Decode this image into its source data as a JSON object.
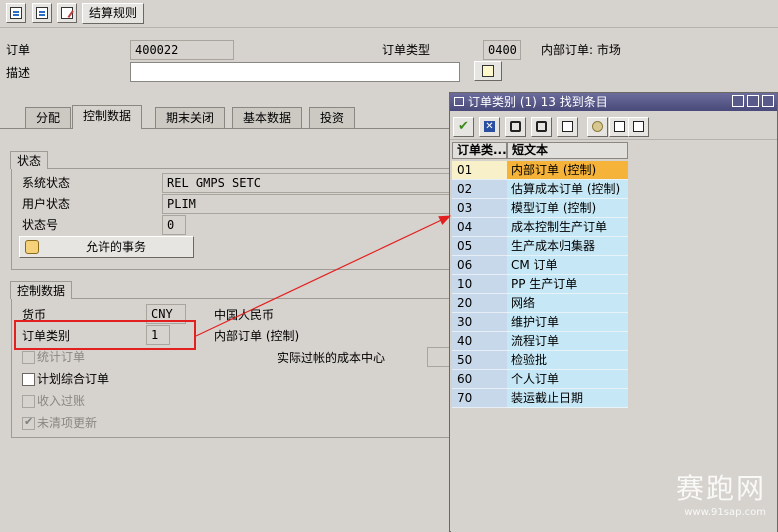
{
  "toolbar": {
    "settlement_rule_label": "结算规则"
  },
  "header": {
    "order_label": "订单",
    "order_value": "400022",
    "order_type_label": "订单类型",
    "order_type_value": "0400",
    "order_type_text": "内部订单: 市场",
    "description_label": "描述",
    "description_value": ""
  },
  "tabs": [
    {
      "label": "分配"
    },
    {
      "label": "控制数据"
    },
    {
      "label": "期末关闭"
    },
    {
      "label": "基本数据"
    },
    {
      "label": "投资"
    }
  ],
  "status_group": {
    "title": "状态",
    "system_status_label": "系统状态",
    "system_status_value": "REL  GMPS SETC",
    "user_status_label": "用户状态",
    "user_status_value": "PLIM",
    "status_number_label": "状态号",
    "status_number_value": "0",
    "allowed_transactions_label": "允许的事务"
  },
  "control_group": {
    "title": "控制数据",
    "currency_label": "货币",
    "currency_value": "CNY",
    "currency_text": "中国人民币",
    "order_category_label": "订单类别",
    "order_category_value": "1",
    "order_category_text": "内部订单 (控制)",
    "statistical_order_label": "统计订单",
    "actual_cost_center_label": "实际过帐的成本中心",
    "plan_integrated_label": "计划综合订单",
    "revenue_posting_label": "收入过账",
    "commitment_update_label": "未清项更新"
  },
  "popup": {
    "title": "订单类别 (1)  13 找到条目",
    "col_code": "订单类...",
    "col_text": "短文本",
    "rows": [
      {
        "code": "01",
        "text": "内部订单 (控制)"
      },
      {
        "code": "02",
        "text": "估算成本订单 (控制)"
      },
      {
        "code": "03",
        "text": "模型订单 (控制)"
      },
      {
        "code": "04",
        "text": "成本控制生产订单"
      },
      {
        "code": "05",
        "text": "生产成本归集器"
      },
      {
        "code": "06",
        "text": "CM 订单"
      },
      {
        "code": "10",
        "text": "PP 生产订单"
      },
      {
        "code": "20",
        "text": "网络"
      },
      {
        "code": "30",
        "text": "维护订单"
      },
      {
        "code": "40",
        "text": "流程订单"
      },
      {
        "code": "50",
        "text": "检验批"
      },
      {
        "code": "60",
        "text": "个人订单"
      },
      {
        "code": "70",
        "text": "装运截止日期"
      }
    ]
  },
  "watermark": {
    "text": "赛跑网",
    "url": "www.91sap.com"
  }
}
